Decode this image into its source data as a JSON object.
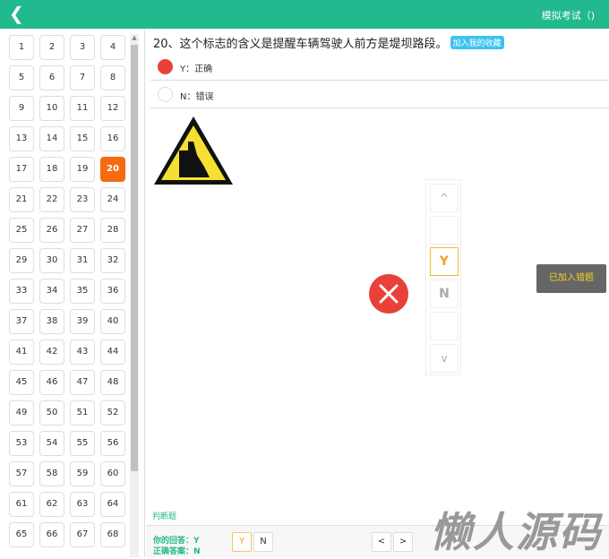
{
  "header": {
    "back_icon": "chevron-left-icon",
    "title": "模拟考试（)"
  },
  "sidebar": {
    "numbers": [
      1,
      2,
      3,
      4,
      5,
      6,
      7,
      8,
      9,
      10,
      11,
      12,
      13,
      14,
      15,
      16,
      17,
      18,
      19,
      20,
      21,
      22,
      23,
      24,
      25,
      26,
      27,
      28,
      29,
      30,
      31,
      32,
      33,
      34,
      35,
      36,
      37,
      38,
      39,
      40,
      41,
      42,
      43,
      44,
      45,
      46,
      47,
      48,
      49,
      50,
      51,
      52,
      53,
      54,
      55,
      56,
      57,
      58,
      59,
      60,
      61,
      62,
      63,
      64,
      65,
      66,
      67,
      68
    ],
    "current": 20
  },
  "question": {
    "text": "20、这个标志的含义是提醒车辆驾驶人前方是堤坝路段。",
    "favorite_label": "加入我的收藏",
    "options": [
      {
        "label": "Y：正确",
        "selected": true
      },
      {
        "label": "N：错误",
        "selected": false
      }
    ],
    "type_label": "判断题"
  },
  "picker": {
    "up": "^",
    "items": [
      "",
      "Y",
      "N",
      ""
    ],
    "down": "v",
    "selected": "Y"
  },
  "toast": "已加入错题",
  "footer": {
    "your_answer": "你的回答：Y",
    "correct_answer": "正确答案：N",
    "y": "Y",
    "n": "N",
    "prev": "<",
    "next": ">"
  },
  "watermark": "懒人源码",
  "colors": {
    "accent": "#21b98d",
    "current": "#f56b0f",
    "wrong": "#e9413a"
  }
}
